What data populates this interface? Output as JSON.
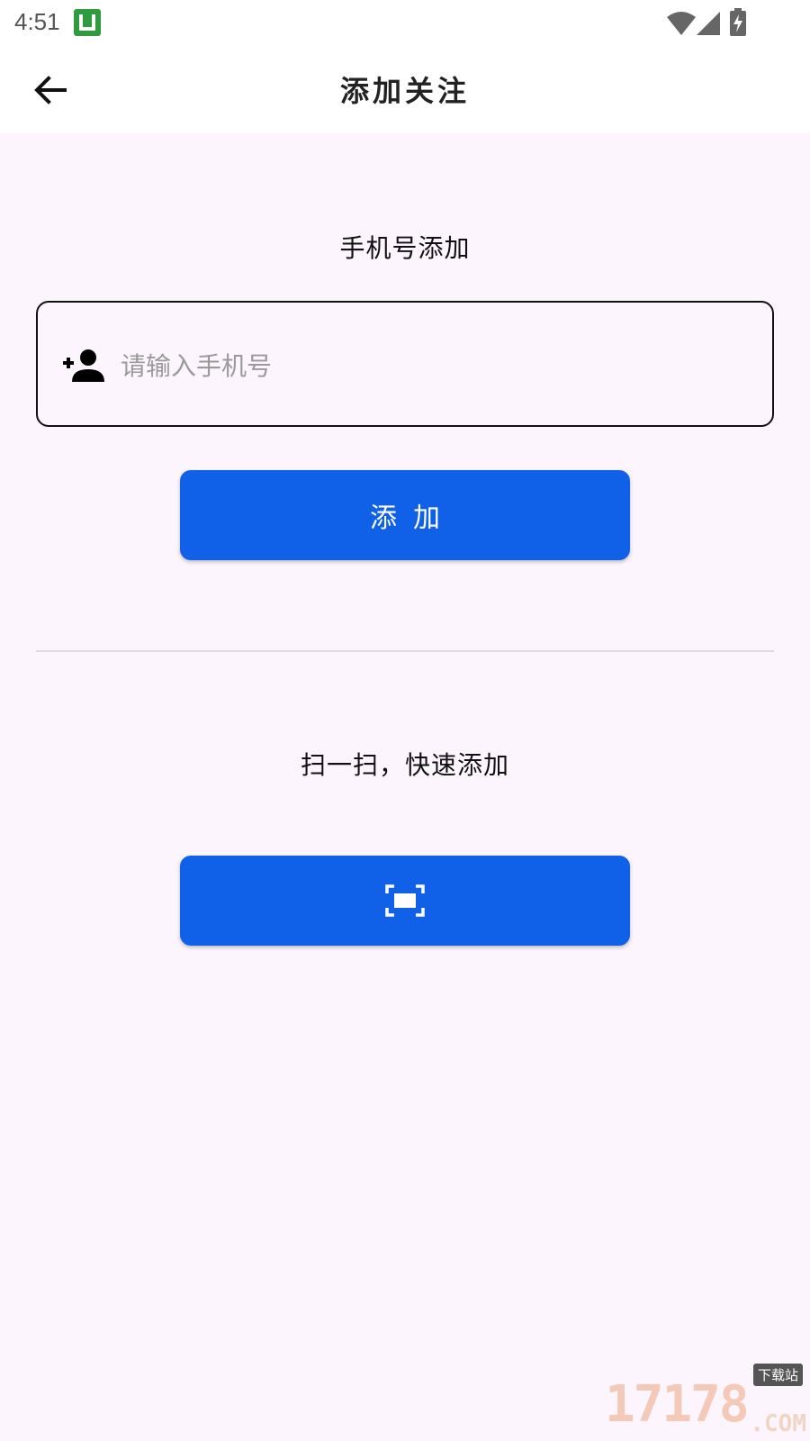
{
  "status_bar": {
    "time": "4:51"
  },
  "header": {
    "title": "添加关注"
  },
  "phone_section": {
    "title": "手机号添加",
    "input_placeholder": "请输入手机号",
    "input_value": "",
    "add_button_label": "添加"
  },
  "scan_section": {
    "title": "扫一扫，快速添加"
  },
  "watermark": {
    "number": "17178",
    "tag": "下载站",
    "suffix": ".COM"
  },
  "icons": {
    "back": "arrow-left-icon",
    "add_person": "person-add-icon",
    "scan": "scan-frame-icon",
    "wifi": "wifi-icon",
    "signal": "signal-icon",
    "battery": "battery-charging-icon"
  },
  "colors": {
    "accent": "#1060e8",
    "background": "#fcf5fd",
    "status_app_icon": "#2e9b3e"
  }
}
